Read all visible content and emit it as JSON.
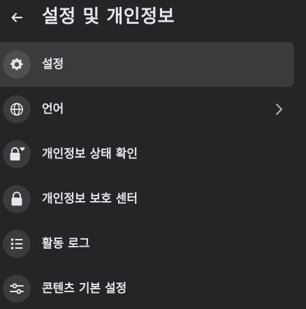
{
  "header": {
    "back_icon": "back-arrow-icon",
    "title": "설정 및 개인정보"
  },
  "menu": {
    "items": [
      {
        "label": "설정",
        "icon": "gear-icon",
        "active": true
      },
      {
        "label": "언어",
        "icon": "globe-icon",
        "has_chevron": true
      },
      {
        "label": "개인정보 상태 확인",
        "icon": "lock-heart-icon"
      },
      {
        "label": "개인정보 보호 센터",
        "icon": "lock-icon"
      },
      {
        "label": "활동 로그",
        "icon": "list-icon"
      },
      {
        "label": "콘텐츠 기본 설정",
        "icon": "sliders-icon"
      }
    ]
  },
  "colors": {
    "background": "#242526",
    "active_row": "#3a3b3c",
    "icon_circle": "#3a3b3c",
    "text": "#e4e6eb"
  }
}
